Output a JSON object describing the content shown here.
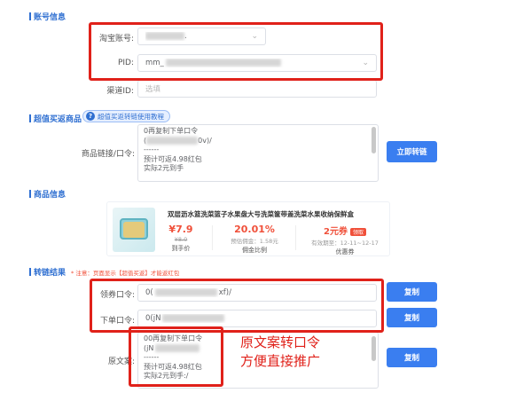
{
  "sections": {
    "account": "账号信息",
    "convert": "超值买返商品",
    "product": "商品信息",
    "result": "转链结果"
  },
  "account": {
    "taobao_label": "淘宝账号:",
    "taobao_suffix": ".",
    "pid_label": "PID:",
    "pid_prefix": "mm_",
    "channel_label": "渠道ID:",
    "channel_placeholder": "选填"
  },
  "convert": {
    "help_chip": "超值买返转链使用教程",
    "input_label": "商品链接/口令:",
    "input_lines": [
      "0再复制下单口令",
      "(",
      "0v)/",
      "------",
      "预计可返4.98红包",
      "实际2元到手"
    ],
    "button": "立即转链"
  },
  "product": {
    "title": "双层沥水篮洗菜篮子水果盘大号洗菜筐带盖洗菜水果收纳保鲜盒",
    "price": "¥7.9",
    "original_price": "¥8.0",
    "price_caption": "到手价",
    "commission_rate": "20.01%",
    "commission_caption": "预估佣金：1.58元",
    "commission_label": "佣金比例",
    "coupon_value": "2元券",
    "coupon_tag": "领取",
    "coupon_validity": "有效期至：12-11~12-17",
    "coupon_label": "优惠券"
  },
  "result": {
    "note": "* 注意：页面显示【超值买返】才能返红包",
    "coupon_label": "领券口令:",
    "coupon_value_start": "0(",
    "coupon_value_end": "xf)/",
    "order_label": "下单口令:",
    "order_value_start": "0(jN",
    "copy_label": "原文案:",
    "copy_lines": [
      "00再复制下单口令",
      "(jN",
      "------",
      "预计可返4.98红包",
      "实际2元到手:/"
    ],
    "copy_button": "复制"
  },
  "annotation": {
    "line1": "原文案转口令",
    "line2": "方便直接推广"
  },
  "colors": {
    "primary": "#3a7ef0",
    "highlight_red": "#e0211a",
    "price_red": "#f0503a"
  }
}
